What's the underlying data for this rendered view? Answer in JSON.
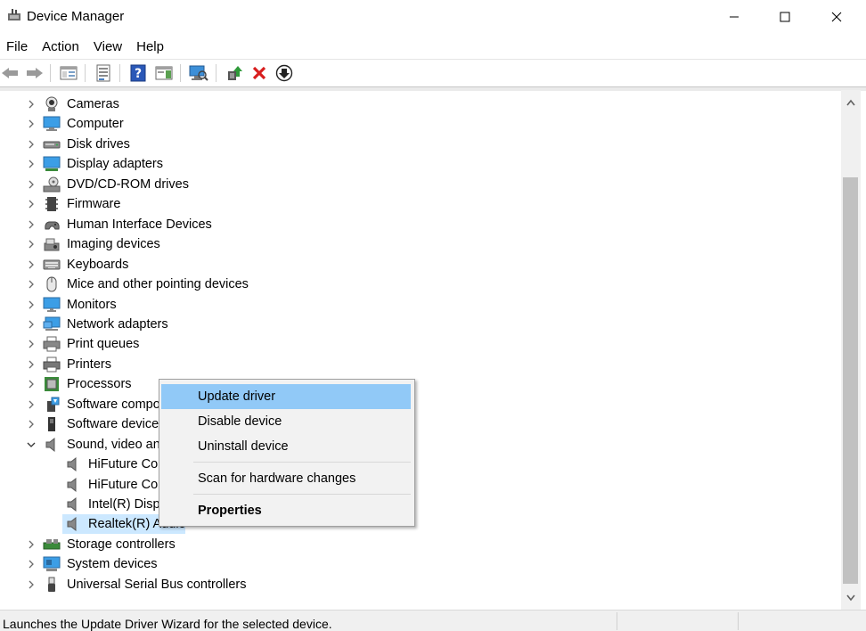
{
  "window": {
    "title": "Device Manager"
  },
  "menu": [
    "File",
    "Action",
    "View",
    "Help"
  ],
  "tree": [
    {
      "label": "Cameras",
      "icon": "camera-icon",
      "level": 0,
      "expander": "collapsed"
    },
    {
      "label": "Computer",
      "icon": "computer-icon",
      "level": 0,
      "expander": "collapsed"
    },
    {
      "label": "Disk drives",
      "icon": "disk-drive-icon",
      "level": 0,
      "expander": "collapsed"
    },
    {
      "label": "Display adapters",
      "icon": "display-adapter-icon",
      "level": 0,
      "expander": "collapsed"
    },
    {
      "label": "DVD/CD-ROM drives",
      "icon": "dvd-drive-icon",
      "level": 0,
      "expander": "collapsed"
    },
    {
      "label": "Firmware",
      "icon": "firmware-icon",
      "level": 0,
      "expander": "collapsed"
    },
    {
      "label": "Human Interface Devices",
      "icon": "hid-icon",
      "level": 0,
      "expander": "collapsed"
    },
    {
      "label": "Imaging devices",
      "icon": "imaging-device-icon",
      "level": 0,
      "expander": "collapsed"
    },
    {
      "label": "Keyboards",
      "icon": "keyboard-icon",
      "level": 0,
      "expander": "collapsed"
    },
    {
      "label": "Mice and other pointing devices",
      "icon": "mouse-icon",
      "level": 0,
      "expander": "collapsed"
    },
    {
      "label": "Monitors",
      "icon": "monitor-icon",
      "level": 0,
      "expander": "collapsed"
    },
    {
      "label": "Network adapters",
      "icon": "network-adapter-icon",
      "level": 0,
      "expander": "collapsed"
    },
    {
      "label": "Print queues",
      "icon": "print-queue-icon",
      "level": 0,
      "expander": "collapsed"
    },
    {
      "label": "Printers",
      "icon": "printer-icon",
      "level": 0,
      "expander": "collapsed"
    },
    {
      "label": "Processors",
      "icon": "processor-icon",
      "level": 0,
      "expander": "collapsed"
    },
    {
      "label": "Software compo",
      "icon": "software-component-icon",
      "level": 0,
      "expander": "collapsed"
    },
    {
      "label": "Software device",
      "icon": "software-device-icon",
      "level": 0,
      "expander": "collapsed"
    },
    {
      "label": "Sound, video an",
      "icon": "speaker-icon",
      "level": 0,
      "expander": "expanded"
    },
    {
      "label": "HiFuture Co",
      "icon": "speaker-icon",
      "level": 1,
      "expander": "none"
    },
    {
      "label": "HiFuture Co",
      "icon": "speaker-icon",
      "level": 1,
      "expander": "none"
    },
    {
      "label": "Intel(R) Disp",
      "icon": "speaker-icon",
      "level": 1,
      "expander": "none"
    },
    {
      "label": "Realtek(R) Audio",
      "icon": "speaker-icon",
      "level": 1,
      "expander": "none",
      "selected": true
    },
    {
      "label": "Storage controllers",
      "icon": "storage-controller-icon",
      "level": 0,
      "expander": "collapsed"
    },
    {
      "label": "System devices",
      "icon": "system-device-icon",
      "level": 0,
      "expander": "collapsed"
    },
    {
      "label": "Universal Serial Bus controllers",
      "icon": "usb-icon",
      "level": 0,
      "expander": "collapsed"
    }
  ],
  "context_menu": {
    "items": [
      {
        "label": "Update driver",
        "highlighted": true
      },
      {
        "label": "Disable device"
      },
      {
        "label": "Uninstall device"
      },
      {
        "label": "Scan for hardware changes"
      },
      {
        "label": "Properties",
        "bold": true
      }
    ]
  },
  "status": {
    "text": "Launches the Update Driver Wizard for the selected device."
  },
  "colors": {
    "selection": "#cce8ff",
    "menu_highlight": "#91c9f7",
    "menu_bg": "#f2f2f2",
    "scroll_thumb": "#c1c1c1"
  }
}
